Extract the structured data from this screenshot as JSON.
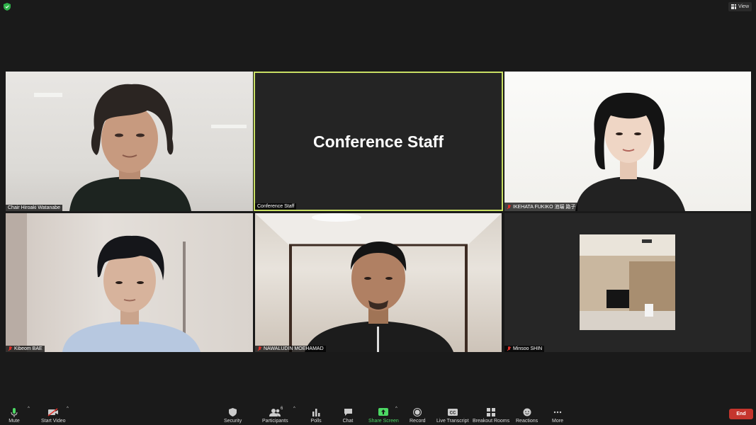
{
  "topbar": {
    "view_label": "View"
  },
  "tiles": [
    {
      "name": "Chair Hiroaki Watanabe",
      "muted": false,
      "has_video": true
    },
    {
      "name": "Conference Staff",
      "muted": false,
      "has_video": false,
      "display_name": "Conference Staff",
      "active_speaker": true
    },
    {
      "name": "IKEHATA FUKIKO 池端 路子",
      "muted": true,
      "has_video": true
    },
    {
      "name": "Kibeom BAE",
      "muted": true,
      "has_video": true
    },
    {
      "name": "NAWALUDIN MOEHAMAD",
      "muted": true,
      "has_video": true
    },
    {
      "name": "Minsoo SHIN",
      "muted": true,
      "has_video": true
    }
  ],
  "toolbar": {
    "mute": "Mute",
    "start_video": "Start Video",
    "security": "Security",
    "participants": "Participants",
    "participants_count": "6",
    "polls": "Polls",
    "chat": "Chat",
    "share_screen": "Share Screen",
    "record": "Record",
    "live_transcript": "Live Transcript",
    "breakout_rooms": "Breakout Rooms",
    "reactions": "Reactions",
    "more": "More",
    "end": "End"
  },
  "colors": {
    "active_speaker_border": "#c8de63",
    "end_button": "#c5352d",
    "share_screen": "#4cd964",
    "muted_mic": "#e0312b"
  }
}
